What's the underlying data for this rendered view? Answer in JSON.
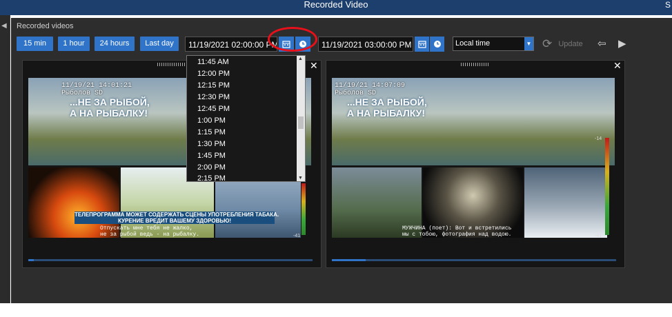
{
  "window": {
    "title": "Recorded Video",
    "corner_text": "S"
  },
  "panel": {
    "label": "Recorded videos"
  },
  "toolbar": {
    "quick_ranges": [
      "15 min",
      "1 hour",
      "24 hours",
      "Last day"
    ],
    "start_datetime": "11/19/2021 02:00:00 PM",
    "end_datetime": "11/19/2021 03:00:00 PM",
    "calendar_icon": "calendar-icon",
    "clock_icon": "clock-icon",
    "timezone": "Local time",
    "update_label": "Update"
  },
  "time_dropdown": {
    "options": [
      "11:45 AM",
      "12:00 PM",
      "12:15 PM",
      "12:30 PM",
      "12:45 PM",
      "1:00 PM",
      "1:15 PM",
      "1:30 PM",
      "1:45 PM",
      "2:00 PM",
      "2:15 PM"
    ]
  },
  "videos": [
    {
      "timestamp": "11/19/21 14:01:21",
      "channel": "Рыболов SD",
      "slogan_line1": "...НЕ ЗА РЫБОЙ,",
      "slogan_line2": "А НА РЫБАЛКУ!",
      "warning": "ТЕЛЕПРОГРАММА МОЖЕТ СОДЕРЖАТЬ СЦЕНЫ УПОТРЕБЛЕНИЯ ТАБАКА.\nКУРЕНИЕ ВРЕДИТ ВАШЕМУ ЗДОРОВЬЮ!",
      "caption": "Отпускать мне тебя не жалко,\nне за рыбой ведь - на рыбалку.",
      "meter_top": "",
      "meter_bottom": "-41",
      "progress": 0.02
    },
    {
      "timestamp": "11/19/21 14:07:09",
      "channel": "Рыболов SD",
      "slogan_line1": "...НЕ ЗА РЫБОЙ,",
      "slogan_line2": "А НА РЫБАЛКУ!",
      "warning": "",
      "caption": "МУЖЧИНА (поет): Вот и встретились\nмы с тобою, фотография над водою.",
      "meter_top": "-14",
      "meter_bottom": "-41",
      "progress": 0.12
    }
  ],
  "colors": {
    "accent": "#2f74c9",
    "titlebar": "#1d3f6e",
    "panel": "#2d2d2d",
    "highlight": "#e8101a"
  }
}
